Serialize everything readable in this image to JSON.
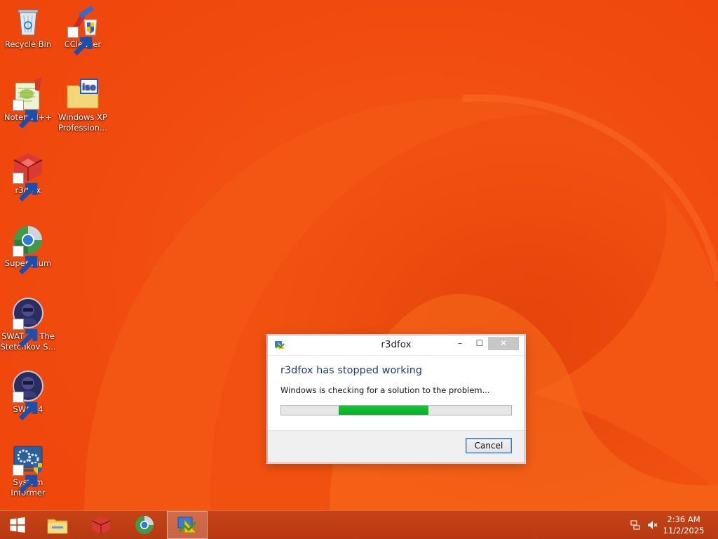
{
  "desktop": {
    "icons": [
      {
        "label": "Recycle Bin"
      },
      {
        "label": "CCleaner"
      },
      {
        "label": "Notepad++"
      },
      {
        "label": "Windows XP Profession..."
      },
      {
        "label": "r3dfox"
      },
      {
        "label": "Supermium"
      },
      {
        "label": "SWAT 4 - The Stetchkov S..."
      },
      {
        "label": "SWAT 4"
      },
      {
        "label": "System Informer"
      }
    ]
  },
  "dialog": {
    "title": "r3dfox",
    "minimize": "–",
    "maximize": "☐",
    "close": "✕",
    "main_instruction": "r3dfox has stopped working",
    "content": "Windows is checking for a solution to the problem...",
    "cancel_label": "Cancel",
    "progress": "marquee"
  },
  "taskbar": {
    "items": [
      {
        "icon": "windows-start-icon"
      },
      {
        "icon": "file-explorer-icon"
      },
      {
        "icon": "r3dfox-icon"
      },
      {
        "icon": "supermium-icon"
      },
      {
        "icon": "problem-reporting-icon",
        "active": true
      }
    ],
    "tray": {
      "time": "2:36 AM",
      "date": "11/2/2025",
      "icons": [
        "network-icon",
        "volume-muted-icon"
      ]
    }
  },
  "colors": {
    "accent": "#1e3c7a",
    "progress_green": "#06b025",
    "taskbar": "#bd3e14",
    "wallpaper": "#f24e12"
  }
}
